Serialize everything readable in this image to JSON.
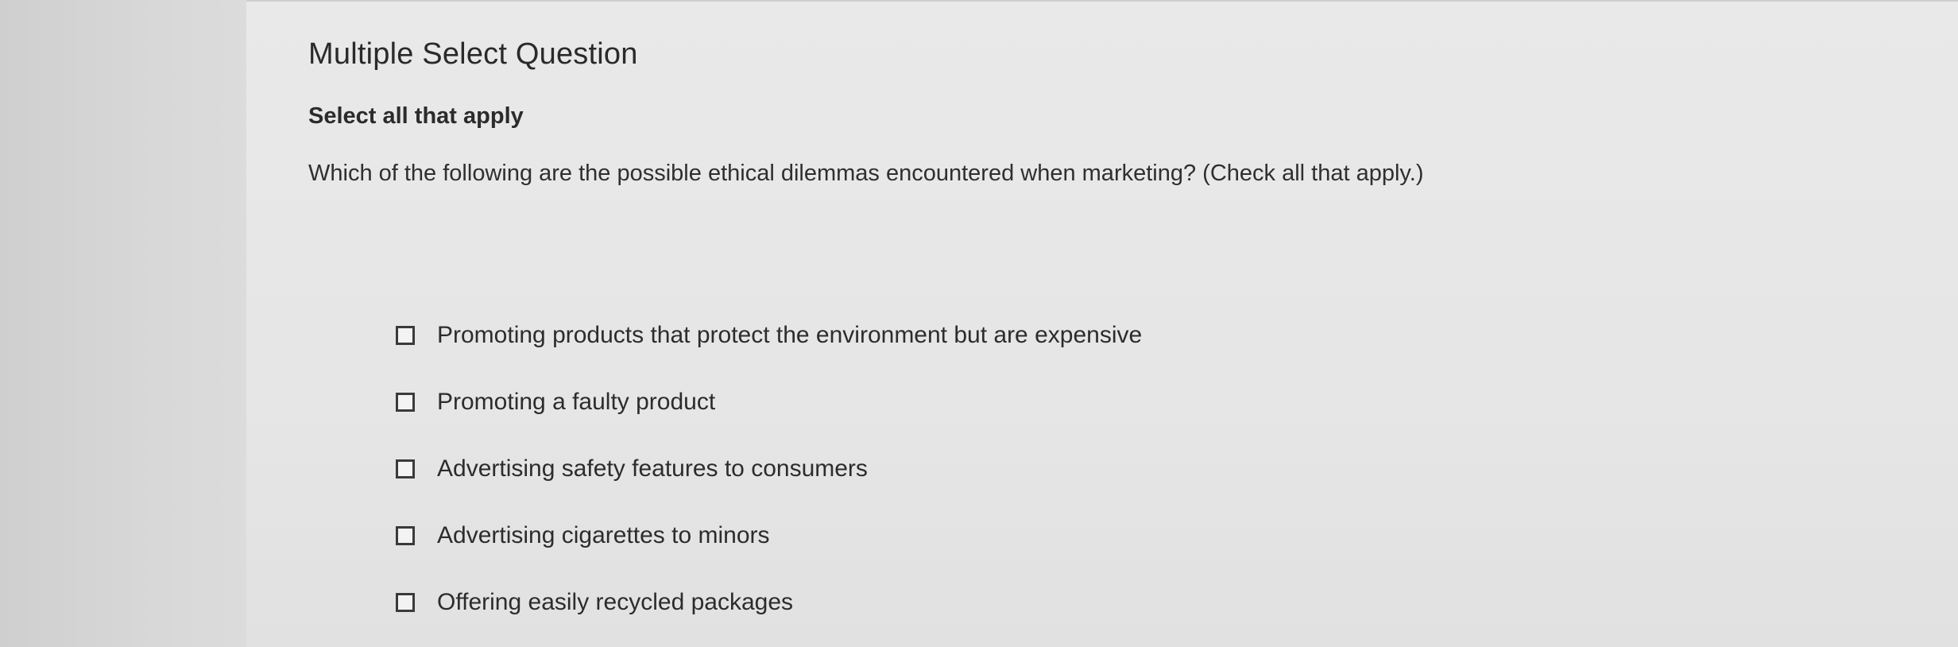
{
  "question": {
    "type_title": "Multiple Select Question",
    "instruction": "Select all that apply",
    "prompt": "Which of the following are the possible ethical dilemmas encountered when marketing? (Check all that apply.)"
  },
  "options": [
    {
      "label": "Promoting products that protect the environment but are expensive",
      "checked": false
    },
    {
      "label": "Promoting a faulty product",
      "checked": false
    },
    {
      "label": "Advertising safety features to consumers",
      "checked": false
    },
    {
      "label": "Advertising cigarettes to minors",
      "checked": false
    },
    {
      "label": "Offering easily recycled packages",
      "checked": false
    }
  ]
}
